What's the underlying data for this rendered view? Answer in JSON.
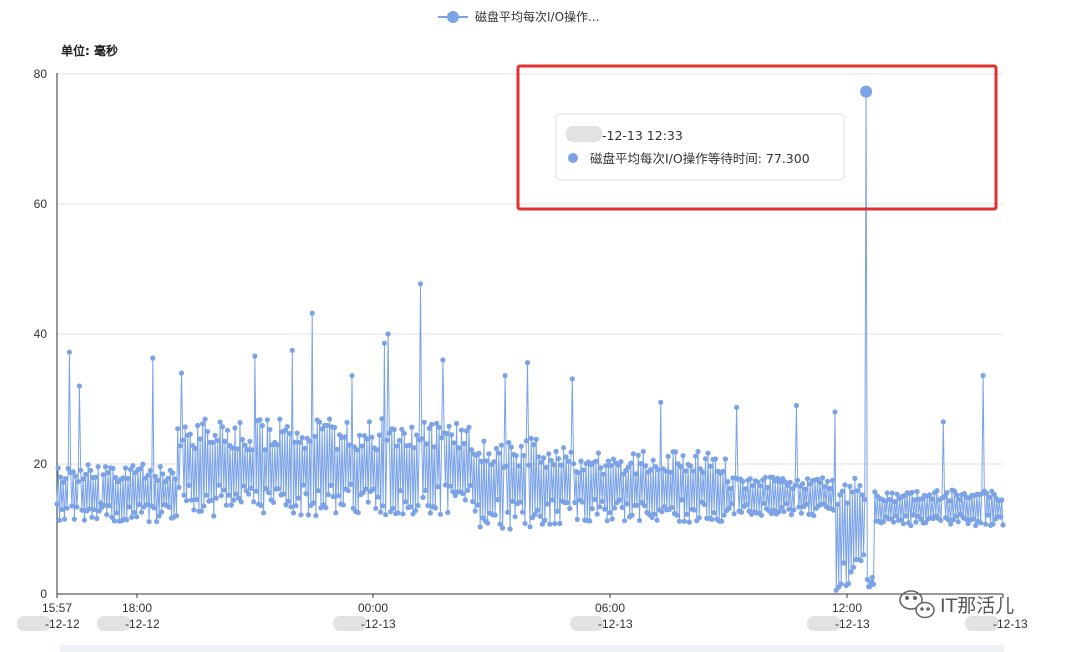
{
  "legend": {
    "label": "磁盘平均每次I/O操作..."
  },
  "unit_label": "单位: 毫秒",
  "tooltip": {
    "time": "-12-13 12:33",
    "series_label": "磁盘平均每次I/O操作等待时间: 77.300"
  },
  "watermark": "IT那活儿",
  "colors": {
    "series": "#7ba3e6",
    "grid": "#e0e0e0",
    "axis": "#333333",
    "highlight_box": "#e03030",
    "tooltip_border": "#dddddd"
  },
  "chart_data": {
    "type": "line",
    "series": [
      {
        "name": "磁盘平均每次I/O操作...",
        "marker": "circle"
      }
    ],
    "ylim": [
      0,
      80
    ],
    "yticks": [
      0,
      20,
      40,
      60,
      80
    ],
    "x_range": [
      "15:57",
      "-12-13 ~23:30"
    ],
    "xticks": [
      {
        "time": "15:57",
        "date": "-12-12"
      },
      {
        "time": "18:00",
        "date": "-12-12"
      },
      {
        "time": "00:00",
        "date": "-12-13"
      },
      {
        "time": "06:00",
        "date": "-12-13"
      },
      {
        "time": "12:00",
        "date": "-12-13"
      },
      {
        "time": "",
        "date": "-12-13"
      }
    ],
    "highlight": {
      "time": "12:33",
      "value": 77.3
    },
    "spikes": [
      {
        "time": "16:16",
        "value": 37.2
      },
      {
        "time": "17:03",
        "value": 14.0
      },
      {
        "time": "18:24",
        "value": 36.3
      },
      {
        "time": "19:07",
        "value": 34.0
      },
      {
        "time": "21:00",
        "value": 36.6
      },
      {
        "time": "21:57",
        "value": 37.5
      },
      {
        "time": "22:27",
        "value": 43.2
      },
      {
        "time": "23:27",
        "value": 33.6
      },
      {
        "time": "00:17",
        "value": 38.6
      },
      {
        "time": "00:24",
        "value": 40.0
      },
      {
        "time": "01:13",
        "value": 47.7
      },
      {
        "time": "01:47",
        "value": 36.0
      },
      {
        "time": "03:22",
        "value": 33.6
      },
      {
        "time": "03:57",
        "value": 35.6
      },
      {
        "time": "05:05",
        "value": 33.1
      },
      {
        "time": "07:20",
        "value": 29.5
      },
      {
        "time": "09:15",
        "value": 28.7
      },
      {
        "time": "10:48",
        "value": 29.0
      },
      {
        "time": "11:47",
        "value": 28.0
      },
      {
        "time": "14:32",
        "value": 26.5
      },
      {
        "time": "15:32",
        "value": 33.6
      },
      {
        "time": "16:32",
        "value": 32.0
      }
    ],
    "segments": [
      {
        "from": "15:57",
        "to": "19:00",
        "typical_min": 11,
        "typical_max": 20
      },
      {
        "from": "19:00",
        "to": "02:30",
        "typical_min": 12,
        "typical_max": 27
      },
      {
        "from": "02:30",
        "to": "05:00",
        "typical_min": 10,
        "typical_max": 24
      },
      {
        "from": "05:00",
        "to": "09:00",
        "typical_min": 11,
        "typical_max": 22
      },
      {
        "from": "09:00",
        "to": "11:45",
        "typical_min": 12,
        "typical_max": 18
      },
      {
        "from": "11:45",
        "to": "12:40",
        "typical_min": 0.5,
        "typical_max": 18
      },
      {
        "from": "12:40",
        "to": "17:00",
        "typical_min": 10.5,
        "typical_max": 16
      }
    ]
  }
}
